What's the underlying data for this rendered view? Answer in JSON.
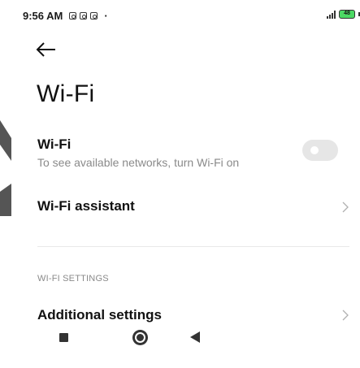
{
  "status_bar": {
    "time": "9:56 AM",
    "battery": "48",
    "more_indicator": "·",
    "notification_icons": [
      "notification-icon",
      "notification-icon",
      "notification-icon"
    ]
  },
  "header": {
    "back_icon": "back-arrow-icon",
    "title": "Wi-Fi"
  },
  "wifi_row": {
    "title": "Wi-Fi",
    "subtitle": "To see available networks, turn Wi-Fi on",
    "toggle_on": false
  },
  "assistant_row": {
    "title": "Wi-Fi assistant"
  },
  "section": {
    "header": "WI-FI SETTINGS"
  },
  "additional_row": {
    "title": "Additional settings"
  },
  "nav_bar": {
    "icons": [
      "recents-icon",
      "home-icon",
      "back-icon"
    ]
  },
  "colors": {
    "toggle_off": "#e6e6e6",
    "subtitle": "#8a8a8a",
    "battery": "#4cd964"
  }
}
